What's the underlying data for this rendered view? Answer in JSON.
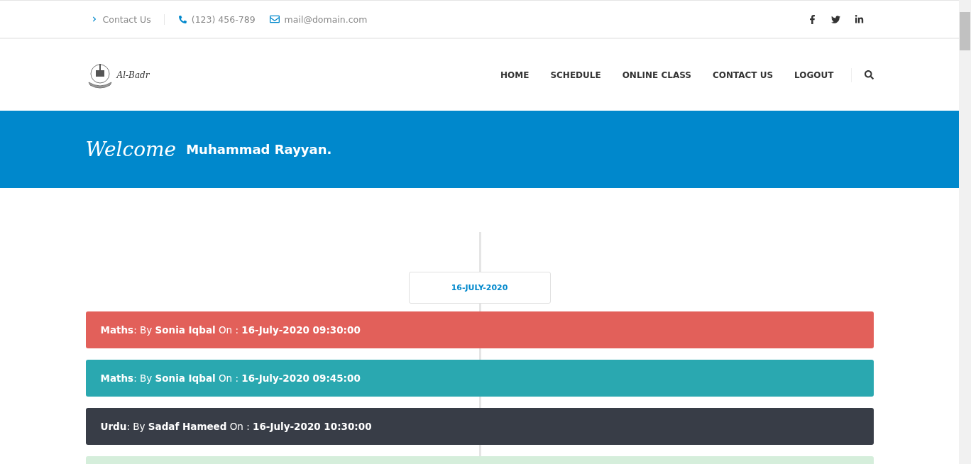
{
  "topbar": {
    "contact_link": "Contact Us",
    "phone": "(123) 456-789",
    "email": "mail@domain.com"
  },
  "logo": {
    "text": "Al-Badr"
  },
  "nav": {
    "items": [
      "HOME",
      "SCHEDULE",
      "ONLINE CLASS",
      "CONTACT US",
      "LOGOUT"
    ]
  },
  "banner": {
    "greeting": "Welcome",
    "name": "Muhammad Rayyan."
  },
  "timeline": {
    "date": "16-JULY-2020",
    "classes": [
      {
        "text": "**Maths**: By **Sonia Iqbal** On : **16-July-2020 09:30:00**",
        "color": "#e2605a"
      },
      {
        "text": "**Maths**: By **Sonia Iqbal** On : **16-July-2020 09:45:00**",
        "color": "#2aa8b0"
      },
      {
        "text": "**Urdu**: By **Sadaf Hameed** On : **16-July-2020 10:30:00**",
        "color": "#383d47"
      },
      {
        "color": "#d5eedb"
      }
    ]
  }
}
